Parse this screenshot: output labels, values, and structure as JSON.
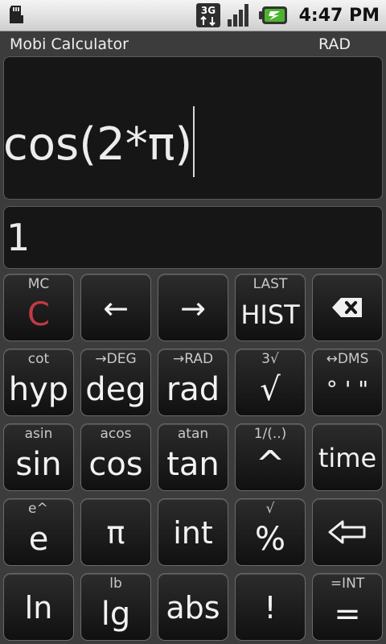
{
  "status": {
    "network": "3G",
    "time": "4:47 PM"
  },
  "app": {
    "title": "Mobi Calculator",
    "angle_mode": "RAD"
  },
  "display": {
    "expression": "cos(2*π)",
    "result": "1"
  },
  "keys": {
    "mc": "MC",
    "clear": "C",
    "left": "←",
    "right": "→",
    "last": "LAST",
    "hist": "HIST",
    "cot": "cot",
    "hyp": "hyp",
    "to_deg": "→DEG",
    "deg": "deg",
    "to_rad": "→RAD",
    "rad": "rad",
    "cbrt": "3√",
    "sqrt": "√",
    "dms_sub": "↔DMS",
    "dms": "° ' \"",
    "asin": "asin",
    "sin": "sin",
    "acos": "acos",
    "cos": "cos",
    "atan": "atan",
    "tan": "tan",
    "recip": "1/(..)",
    "power": "^",
    "time": "time",
    "exp": "e^",
    "e": "e",
    "pi": "π",
    "int": "int",
    "root": "√",
    "percent": "%",
    "ln": "ln",
    "lb": "lb",
    "lg": "lg",
    "abs": "abs",
    "fact": "!",
    "eq_int": "=INT",
    "equals": "="
  }
}
